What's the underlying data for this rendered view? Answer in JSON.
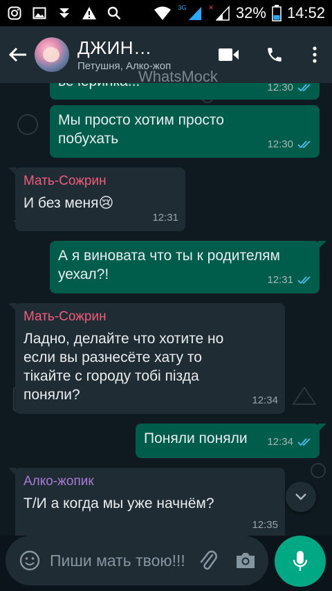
{
  "status_bar": {
    "net_3g": "3G",
    "net_x": "✕",
    "battery": "32%",
    "time": "14:52",
    "icons": [
      "instagram-icon",
      "image-icon",
      "download-icon",
      "warning-icon",
      "search-icon",
      "wifi-icon",
      "signal-icon",
      "battery-icon"
    ]
  },
  "header": {
    "title": "ДЖИН…",
    "subtitle": "Петушня, Алко-жоп",
    "watermark": "WhatsMock"
  },
  "colors": {
    "outgoing": "#005c4b",
    "incoming": "#202c33",
    "sender_pink": "#f15c7d",
    "sender_purple": "#a77bd6",
    "read_ticks": "#53bdeb",
    "accent": "#00a884"
  },
  "messages": [
    {
      "type": "out",
      "text": "вечеринка!!!",
      "time": "12:30"
    },
    {
      "type": "out",
      "text": "Мы просто хотим просто побухать",
      "time": "12:30"
    },
    {
      "type": "in",
      "sender": "Мать-Сожрин",
      "text": "И без меня",
      "emoji": "😢",
      "time": "12:31"
    },
    {
      "type": "out",
      "text": "А я виновата что ты к родителям уехал?!",
      "time": "12:31"
    },
    {
      "type": "in",
      "sender": "Мать-Сожрин",
      "text": "Ладно, делайте что хотите но если вы разнесёте хату то тікайте с городу тобі пізда поняли?",
      "time": "12:34"
    },
    {
      "type": "out",
      "text": "Поняли поняли",
      "time": "12:34"
    },
    {
      "type": "in",
      "sender": "Алко-жопик",
      "text": "Т/И а когда мы уже начнём?",
      "time": "12:35"
    }
  ],
  "input": {
    "placeholder": "Пиши мать твою!!!"
  }
}
